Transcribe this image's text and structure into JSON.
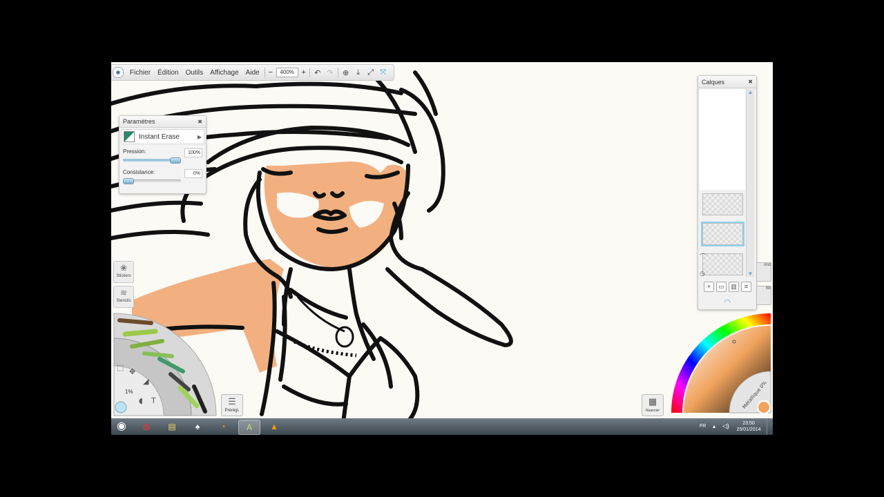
{
  "menu": {
    "items": [
      "Fichier",
      "Édition",
      "Outils",
      "Affichage",
      "Aide"
    ],
    "zoom_minus": "−",
    "zoom_value": "400%",
    "zoom_plus": "+"
  },
  "params": {
    "title": "Paramètres",
    "close": "✖",
    "preset": "Instant Erase",
    "pression_label": "Pression:",
    "pression_value": "100%",
    "pression_level": 1.0,
    "consistance_label": "Consistance:",
    "consistance_value": "0%",
    "consistance_level": 0.0
  },
  "sidetools": {
    "stickers": "Stickers",
    "stencils": "Stencils"
  },
  "wheel": {
    "size_readout": "1%"
  },
  "preset_button": "Prérégl.",
  "layers": {
    "title": "Calques",
    "close": "✖",
    "peek1": "ond",
    "peek2": "Bit"
  },
  "nuancier": "Nuancier",
  "color_wheel": {
    "metallic_label": "Métallique 0%",
    "current_color": "#f0a35e"
  },
  "taskbar": {
    "lang": "FR",
    "time": "23:50",
    "date": "25/01/2014"
  },
  "colors": {
    "skin": "#f2b080",
    "canvas": "#fbfaf5",
    "accent": "#8fd0ef"
  }
}
